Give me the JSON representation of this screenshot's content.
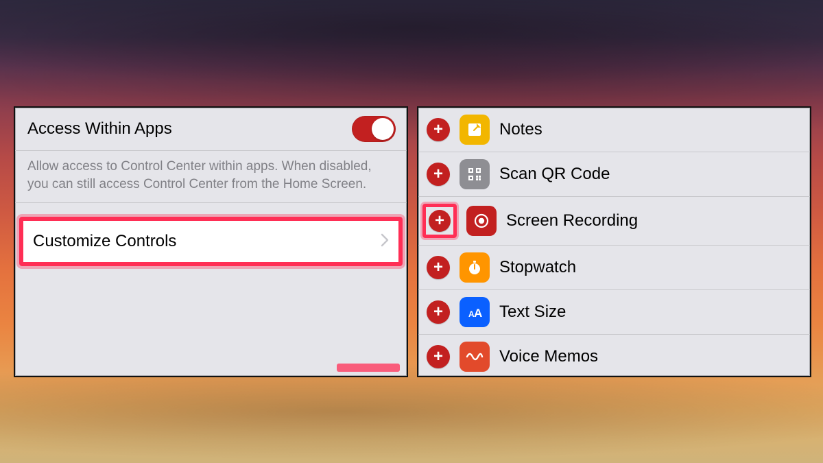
{
  "left": {
    "access_label": "Access Within Apps",
    "access_toggle_on": true,
    "description": "Allow access to Control Center within apps. When disabled, you can still access Control Center from the Home Screen.",
    "customize_label": "Customize Controls"
  },
  "right": {
    "items": [
      {
        "label": "Notes",
        "icon": "notes-icon"
      },
      {
        "label": "Scan QR Code",
        "icon": "qr-icon"
      },
      {
        "label": "Screen Recording",
        "icon": "record-icon",
        "highlighted": true
      },
      {
        "label": "Stopwatch",
        "icon": "stopwatch-icon"
      },
      {
        "label": "Text Size",
        "icon": "textsize-icon"
      },
      {
        "label": "Voice Memos",
        "icon": "voicememo-icon"
      }
    ]
  },
  "colors": {
    "highlight": "#ff2e55",
    "toggle_on": "#c22020",
    "ios_bg": "#e5e5ea"
  }
}
